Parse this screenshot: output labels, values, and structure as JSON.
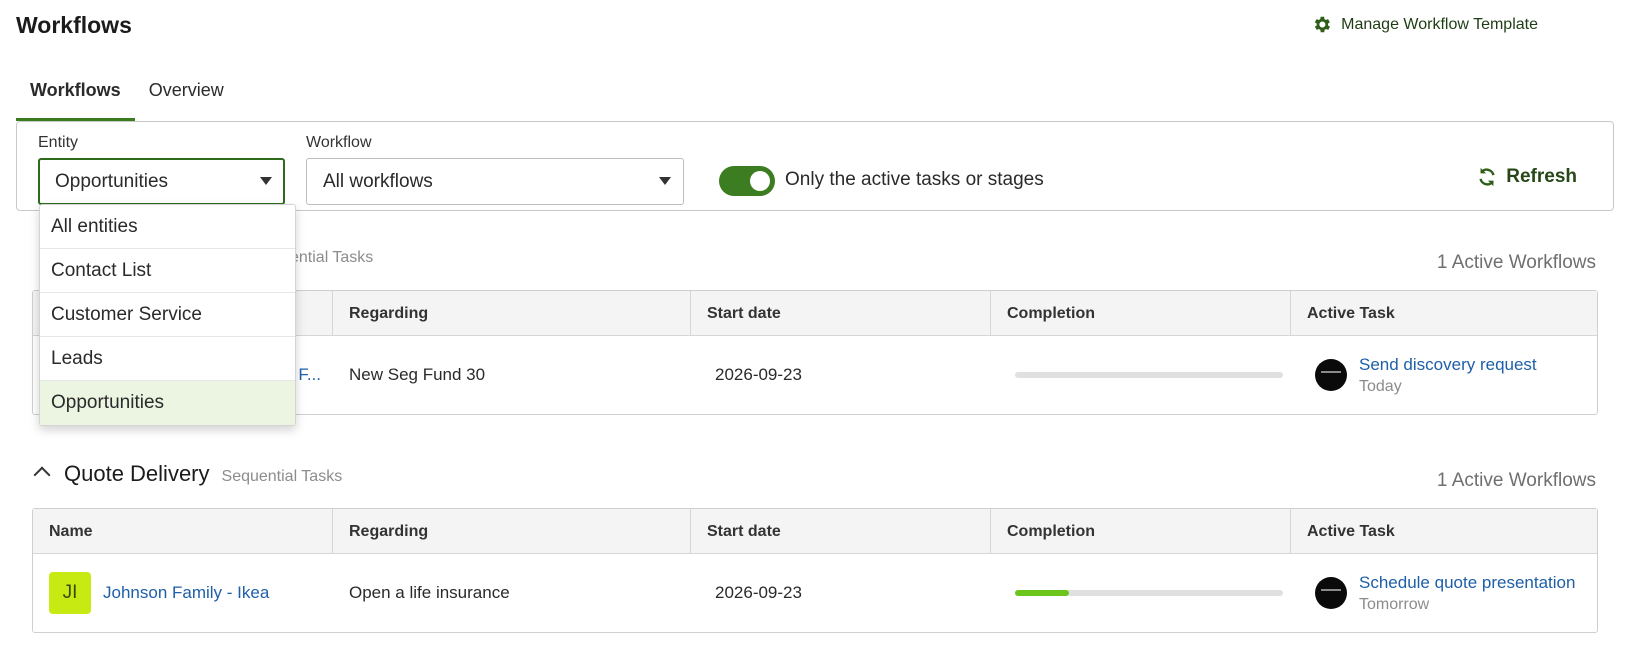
{
  "page": {
    "title": "Workflows",
    "manage_label": "Manage Workflow Template"
  },
  "tabs": [
    {
      "label": "Workflows",
      "active": true
    },
    {
      "label": "Overview",
      "active": false
    }
  ],
  "filters": {
    "entity_label": "Entity",
    "entity_value": "Opportunities",
    "workflow_label": "Workflow",
    "workflow_value": "All workflows",
    "toggle_label": "Only the active tasks or stages",
    "toggle_on": true,
    "refresh_label": "Refresh"
  },
  "entity_options": [
    "All entities",
    "Contact List",
    "Customer Service",
    "Leads",
    "Opportunities"
  ],
  "sections": [
    {
      "title": "",
      "subtitle_visible": "ential Tasks",
      "active_count": "1 Active Workflows",
      "headers": [
        "Regarding",
        "Start date",
        "Completion",
        "Active Task"
      ],
      "row": {
        "name_fragment": "F...",
        "regarding": "New Seg Fund 30",
        "start_date": "2026-09-23",
        "completion": 0.0,
        "task": "Send discovery request",
        "due": "Today"
      }
    },
    {
      "title": "Quote Delivery",
      "subtitle": "Sequential Tasks",
      "active_count": "1 Active Workflows",
      "headers": [
        "Name",
        "Regarding",
        "Start date",
        "Completion",
        "Active Task"
      ],
      "row": {
        "initials": "JI",
        "name": "Johnson Family - Ikea",
        "regarding": "Open a life insurance",
        "start_date": "2026-09-23",
        "completion": 0.2,
        "task": "Schedule quote presentation",
        "due": "Tomorrow"
      }
    }
  ],
  "colors": {
    "accent": "#3d7d22",
    "link": "#1e5fa8",
    "progress": "#6cc51a",
    "avatar": "#c6ea12"
  }
}
